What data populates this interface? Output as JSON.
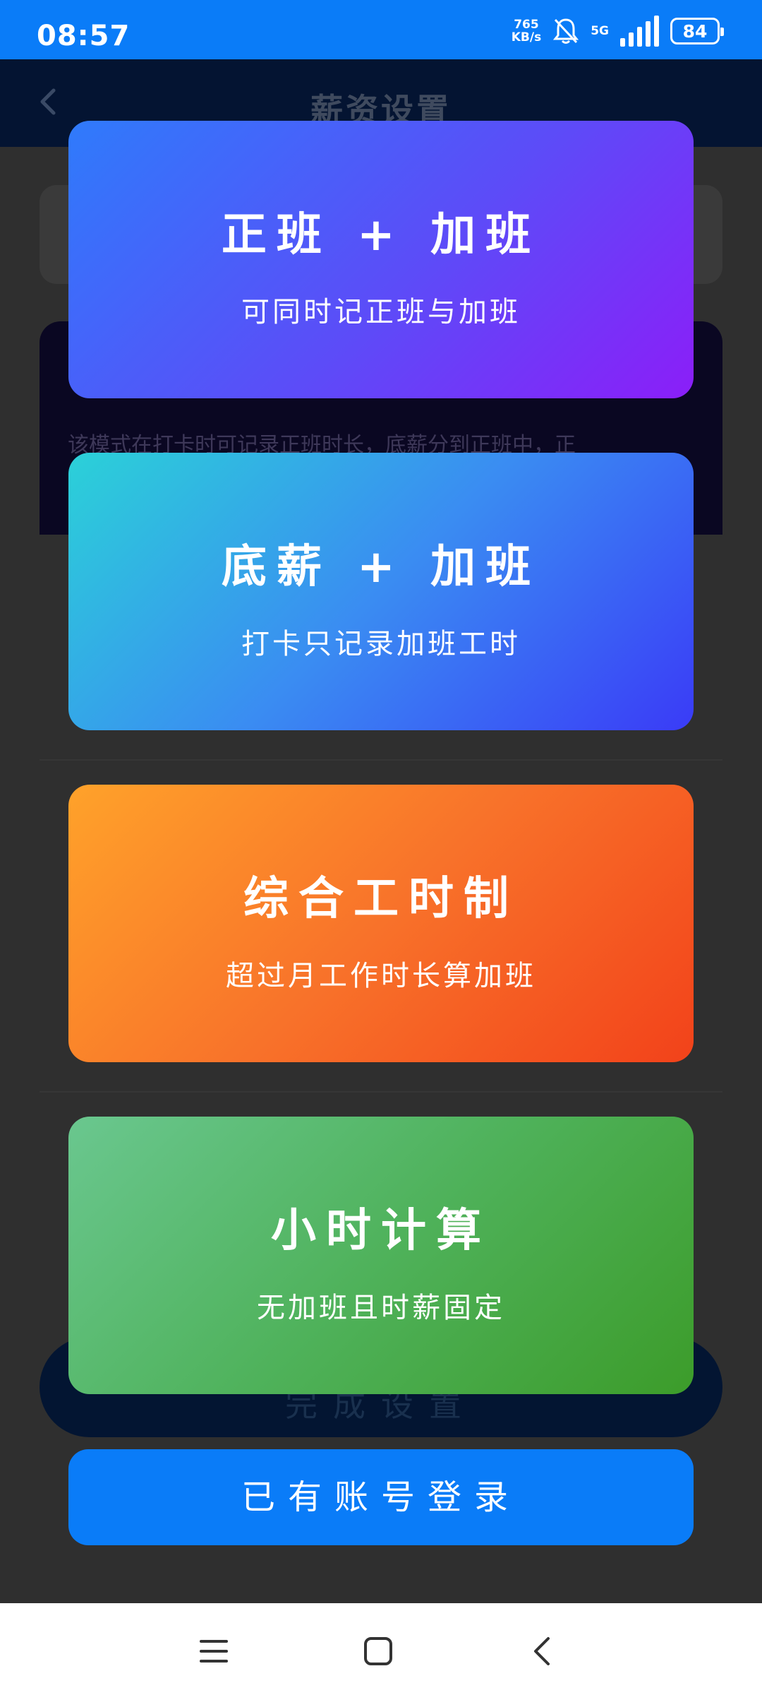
{
  "status_bar": {
    "time": "08:57",
    "net_speed_value": "765",
    "net_speed_unit": "KB/s",
    "network_type": "5G",
    "battery": "84",
    "icons": [
      "bell-muted-icon",
      "signal-icon",
      "battery-icon"
    ]
  },
  "background_page": {
    "title": "薪资设置",
    "info_text": "该模式在打卡时可记录正班时长，底薪分到正班中，正",
    "finish_button": "完成设置"
  },
  "mode_cards": [
    {
      "title": "正班 + 加班",
      "subtitle": "可同时记正班与加班"
    },
    {
      "title": "底薪 + 加班",
      "subtitle": "打卡只记录加班工时"
    },
    {
      "title": "综合工时制",
      "subtitle": "超过月工作时长算加班"
    },
    {
      "title": "小时计算",
      "subtitle": "无加班且时薪固定"
    }
  ],
  "login_button": "已有账号登录",
  "colors": {
    "status_bar": "#0a7cf8",
    "login_button": "#0a7cf8",
    "card_1": "#5c4cf8",
    "card_2": "#3a8cf2",
    "card_3": "#f8722a",
    "card_4": "#4fb25b"
  },
  "nav_bar": {
    "icons": [
      "menu-icon",
      "home-icon",
      "back-icon"
    ]
  }
}
